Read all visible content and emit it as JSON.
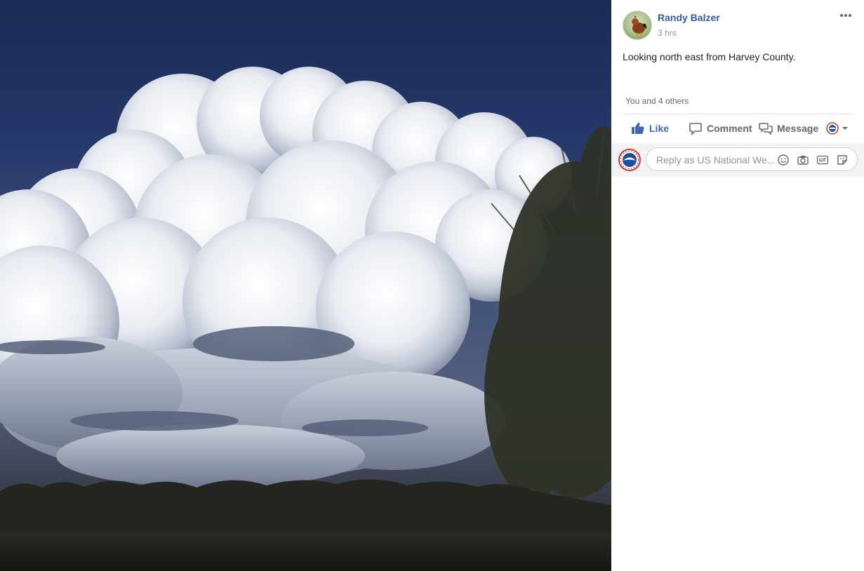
{
  "post": {
    "author": "Randy Balzer",
    "time": "3 hrs",
    "text": "Looking north east from Harvey County.",
    "reactions": "You and 4 others"
  },
  "actions": {
    "like": "Like",
    "comment": "Comment",
    "message": "Message"
  },
  "reply": {
    "placeholder": "Reply as US National We..."
  },
  "icons": {
    "more": "more-options-icon",
    "like": "thumbs-up-icon",
    "comment": "speech-bubble-icon",
    "message": "messenger-bubbles-icon",
    "page_switch": "nws-logo-dropdown-icon",
    "emoji": "smiley-icon",
    "camera": "camera-icon",
    "gif": "gif-icon",
    "sticker": "sticker-icon"
  },
  "colors": {
    "link_blue": "#385898",
    "like_blue": "#4267b2",
    "muted": "#90949c"
  }
}
